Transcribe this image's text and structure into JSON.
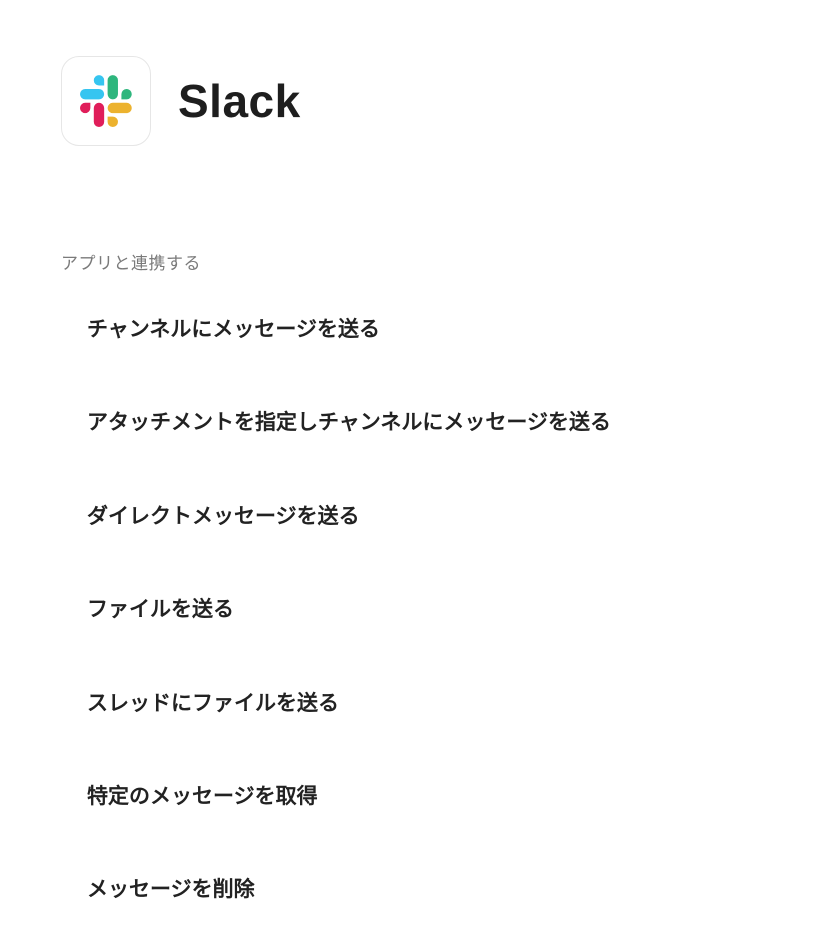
{
  "app": {
    "name": "Slack",
    "logo_icon": "slack-logo",
    "brand_colors": {
      "blue": "#36C5F0",
      "green": "#2EB67D",
      "yellow": "#ECB22E",
      "red": "#E01E5A"
    }
  },
  "section": {
    "label": "アプリと連携する"
  },
  "actions": [
    {
      "label": "チャンネルにメッセージを送る"
    },
    {
      "label": "アタッチメントを指定しチャンネルにメッセージを送る"
    },
    {
      "label": "ダイレクトメッセージを送る"
    },
    {
      "label": "ファイルを送る"
    },
    {
      "label": "スレッドにファイルを送る"
    },
    {
      "label": "特定のメッセージを取得"
    },
    {
      "label": "メッセージを削除"
    }
  ]
}
